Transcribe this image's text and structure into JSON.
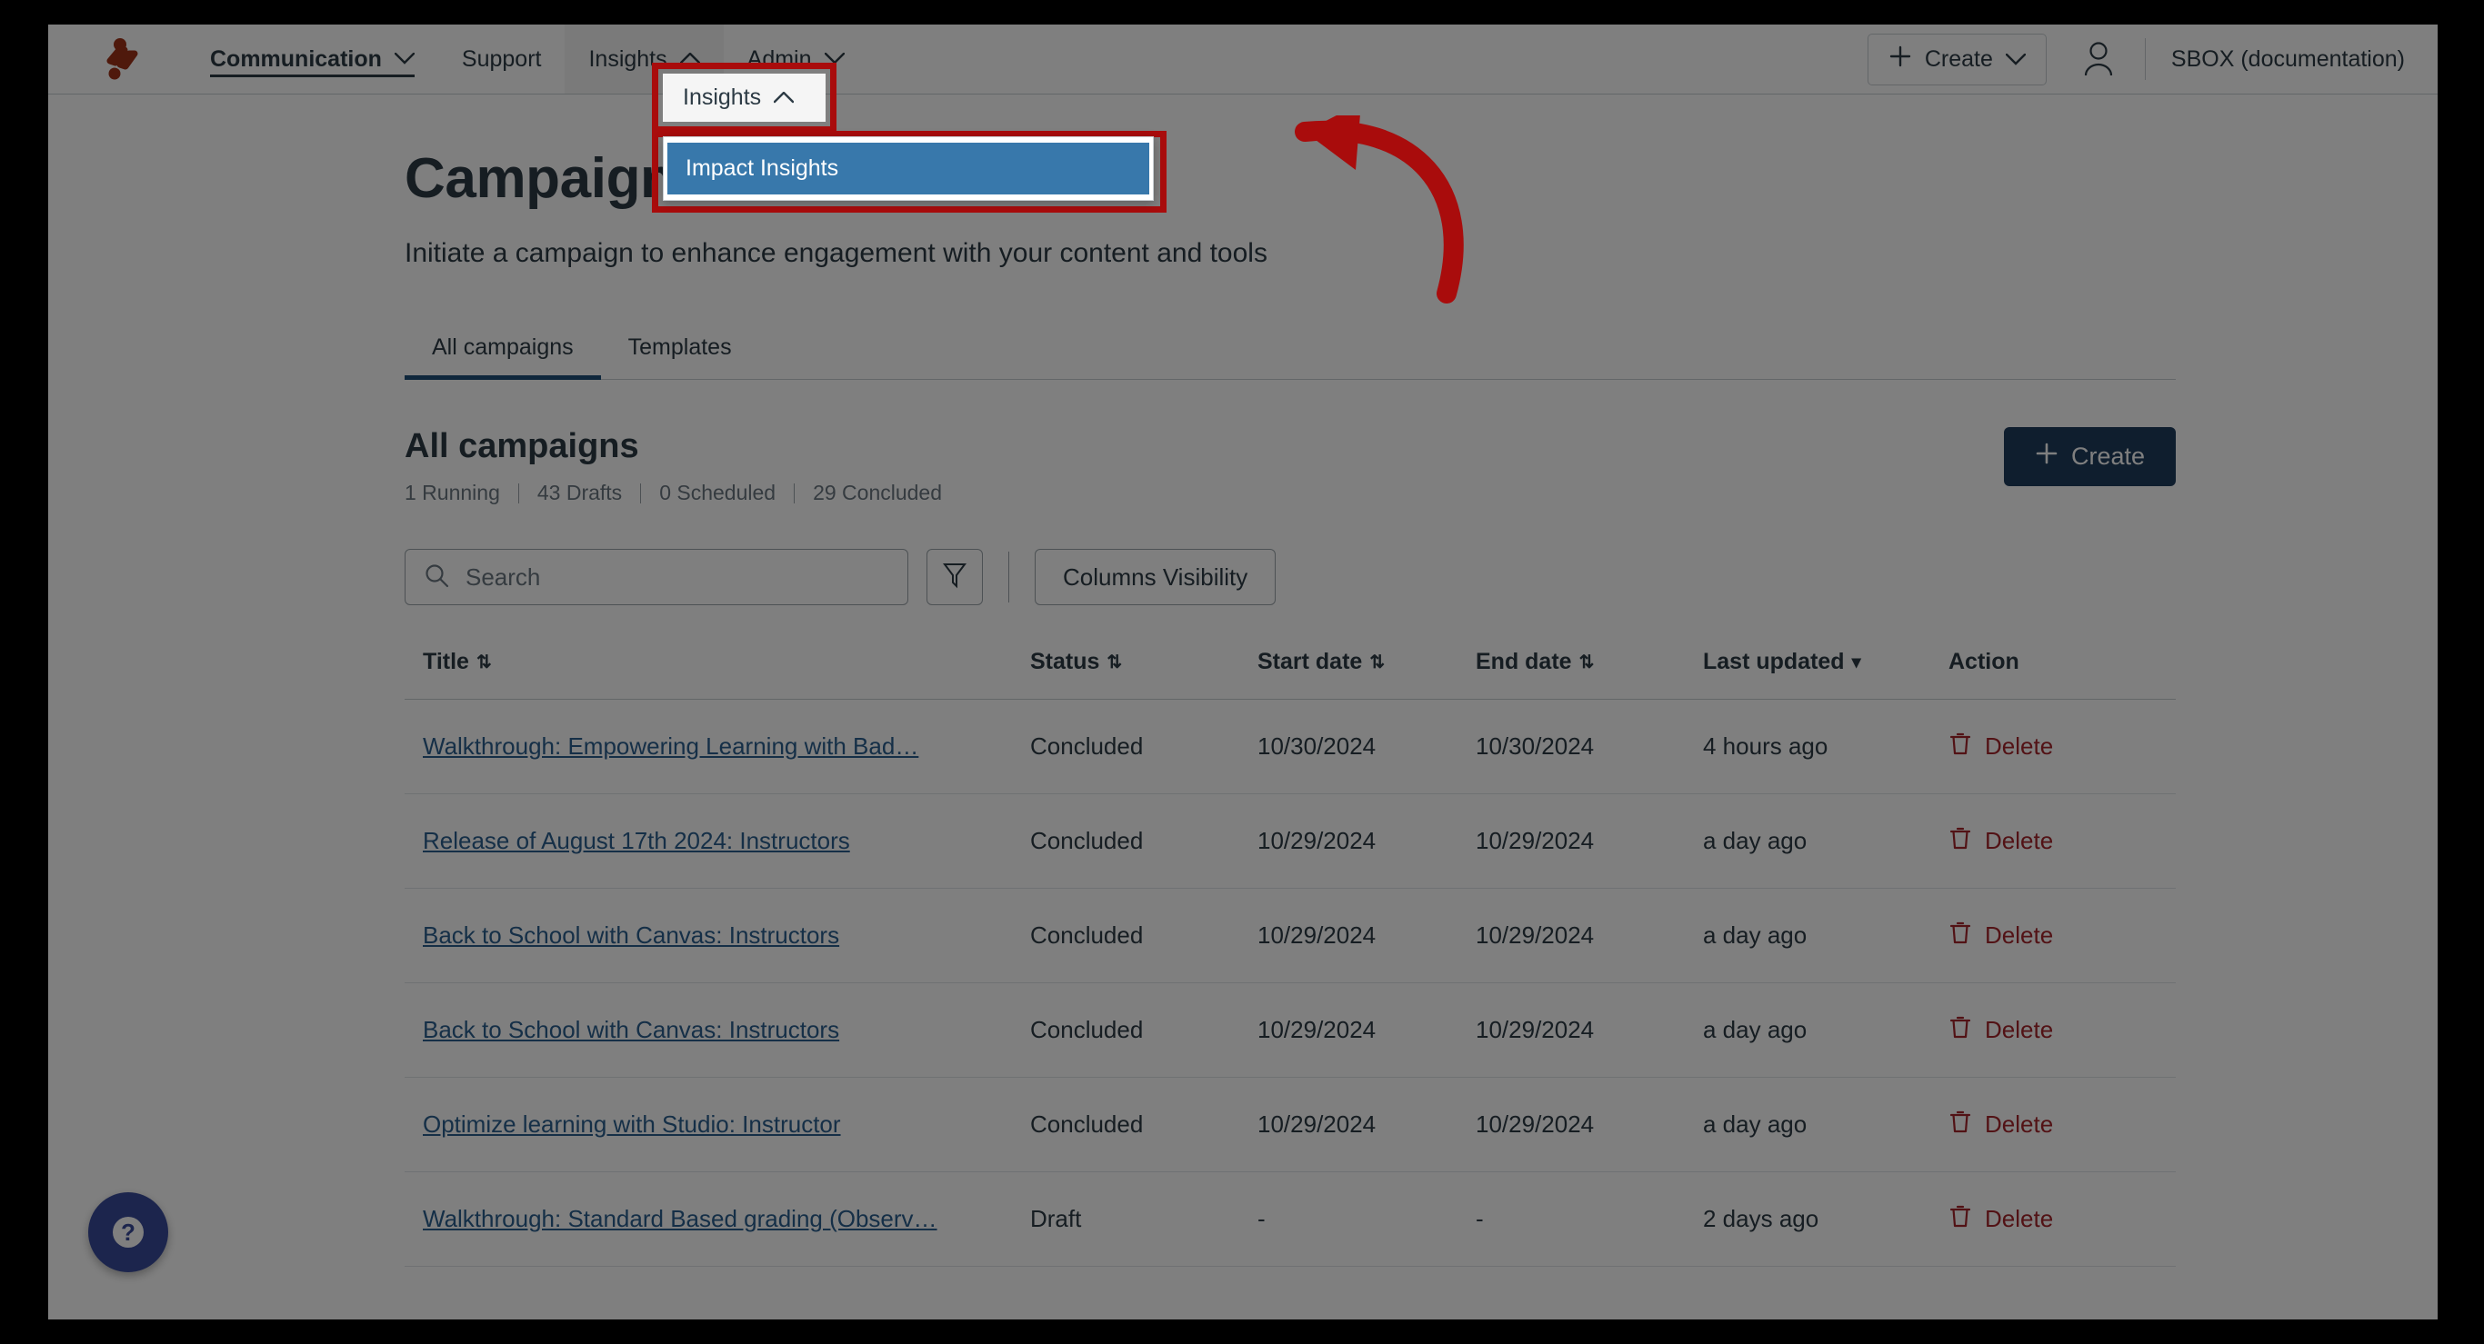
{
  "topnav": {
    "logo_name": "instructure-logo",
    "items": [
      {
        "label": "Communication",
        "caret": "chevron-down",
        "active": true
      },
      {
        "label": "Support",
        "caret": "",
        "active": false
      },
      {
        "label": "Insights",
        "caret": "chevron-up",
        "active": false
      },
      {
        "label": "Admin",
        "caret": "chevron-down",
        "active": false
      }
    ],
    "create_label": "Create",
    "account_name": "SBOX (documentation)"
  },
  "dropdown": {
    "items": [
      {
        "label": "Impact Insights",
        "highlighted": true
      }
    ]
  },
  "page": {
    "title": "Campaigns",
    "subtitle": "Initiate a campaign to enhance engagement with your content and tools"
  },
  "tabs": [
    {
      "label": "All campaigns",
      "selected": true
    },
    {
      "label": "Templates",
      "selected": false
    }
  ],
  "section": {
    "title": "All campaigns",
    "counts": [
      "1 Running",
      "43 Drafts",
      "0 Scheduled",
      "29 Concluded"
    ],
    "create_label": "Create"
  },
  "toolbar": {
    "search_placeholder": "Search",
    "search_value": "",
    "filter_icon": "filter-icon",
    "columns_label": "Columns Visibility"
  },
  "table": {
    "headers": [
      {
        "label": "Title",
        "sort": "both"
      },
      {
        "label": "Status",
        "sort": "both"
      },
      {
        "label": "Start date",
        "sort": "both"
      },
      {
        "label": "End date",
        "sort": "both"
      },
      {
        "label": "Last updated",
        "sort": "desc"
      },
      {
        "label": "Action",
        "sort": "none"
      }
    ],
    "rows": [
      {
        "title": "Walkthrough: Empowering Learning with Bad…",
        "status": "Concluded",
        "start": "10/30/2024",
        "end": "10/30/2024",
        "updated": "4 hours ago",
        "action": "Delete"
      },
      {
        "title": "Release of August 17th 2024: Instructors",
        "status": "Concluded",
        "start": "10/29/2024",
        "end": "10/29/2024",
        "updated": "a day ago",
        "action": "Delete"
      },
      {
        "title": "Back to School with Canvas: Instructors",
        "status": "Concluded",
        "start": "10/29/2024",
        "end": "10/29/2024",
        "updated": "a day ago",
        "action": "Delete"
      },
      {
        "title": "Back to School with Canvas: Instructors",
        "status": "Concluded",
        "start": "10/29/2024",
        "end": "10/29/2024",
        "updated": "a day ago",
        "action": "Delete"
      },
      {
        "title": "Optimize learning with Studio: Instructor",
        "status": "Concluded",
        "start": "10/29/2024",
        "end": "10/29/2024",
        "updated": "a day ago",
        "action": "Delete"
      },
      {
        "title": "Walkthrough: Standard Based grading (Observ…",
        "status": "Draft",
        "start": "-",
        "end": "-",
        "updated": "2 days ago",
        "action": "Delete"
      }
    ]
  },
  "help": {
    "icon": "question-mark-icon"
  },
  "annotation": {
    "highlight_color": "#a90c0c",
    "arrow_color": "#a90c0c"
  },
  "colors": {
    "menu_highlight": "#3878ab",
    "primary_button": "#1f3d5c",
    "link": "#2b5f8e",
    "delete": "#a5242b",
    "tab_indicator": "#1f4e79",
    "logo": "#9e3319",
    "help_fab": "#394B9B"
  }
}
